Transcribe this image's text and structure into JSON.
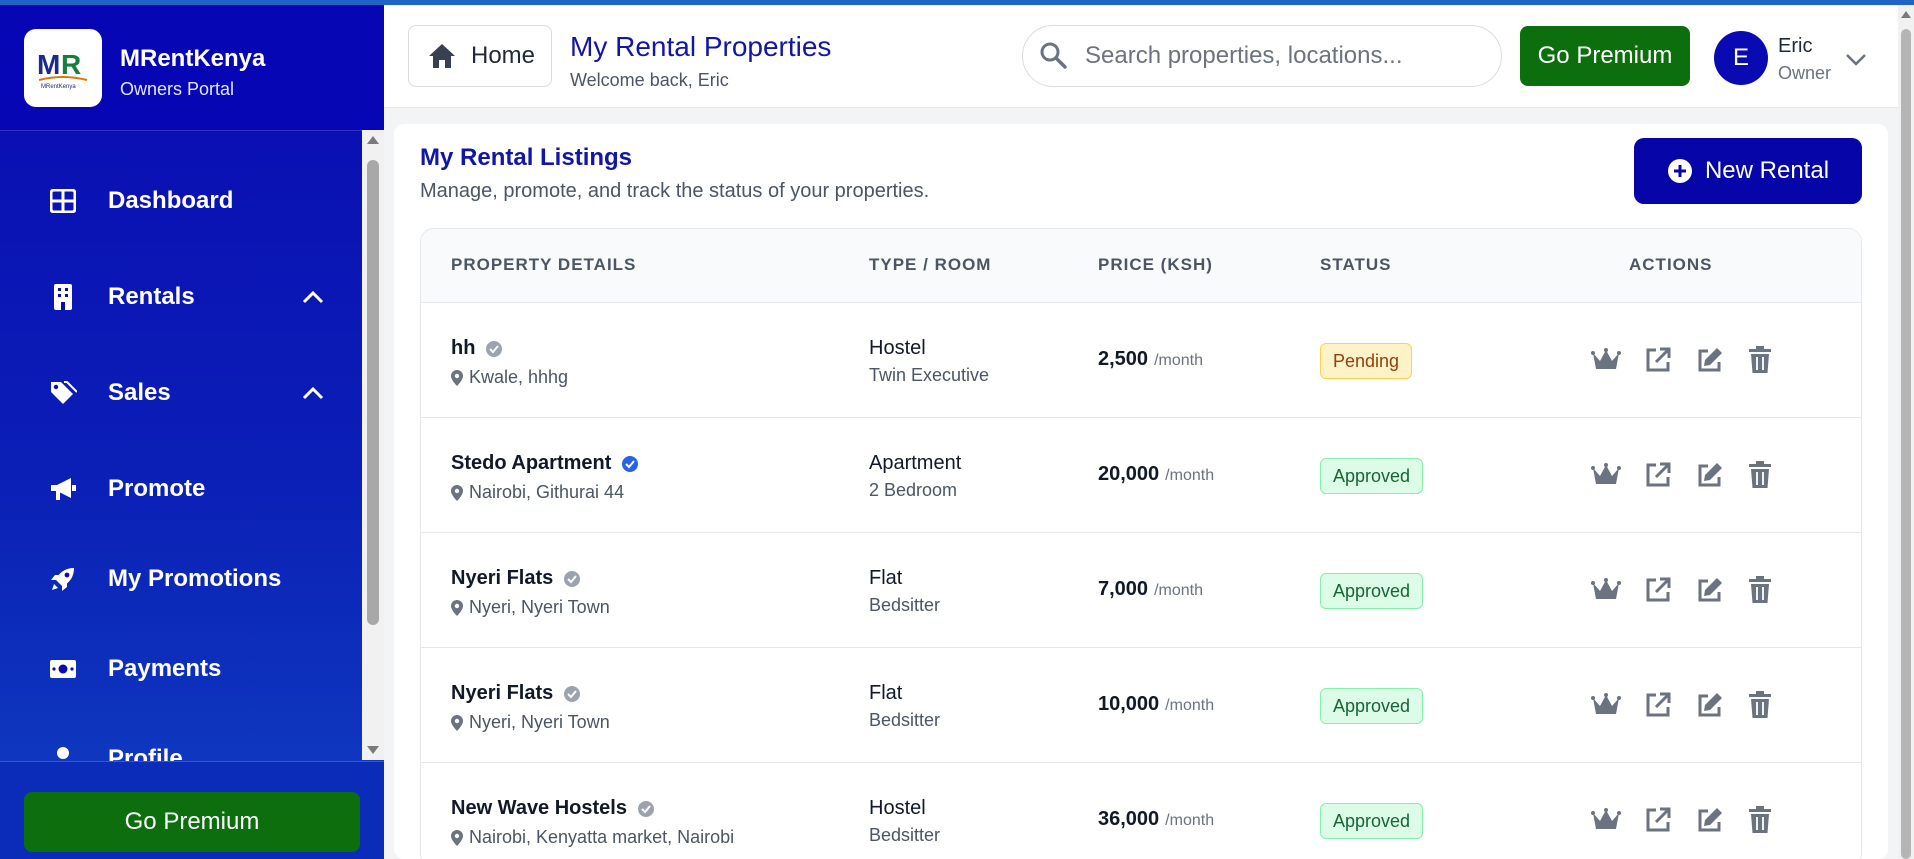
{
  "brand": {
    "name": "MRentKenya",
    "subtitle": "Owners Portal",
    "logo_text": "MR",
    "logo_small": "MRentKenya"
  },
  "sidebar": {
    "items": [
      {
        "label": "Dashboard",
        "icon": "grid-icon"
      },
      {
        "label": "Rentals",
        "icon": "building-icon",
        "expandable": true
      },
      {
        "label": "Sales",
        "icon": "tags-icon",
        "expandable": true
      },
      {
        "label": "Promote",
        "icon": "megaphone-icon"
      },
      {
        "label": "My Promotions",
        "icon": "rocket-icon"
      },
      {
        "label": "Payments",
        "icon": "money-icon"
      },
      {
        "label": "Profile",
        "icon": "user-icon"
      }
    ],
    "premium_label": "Go Premium"
  },
  "header": {
    "home_label": "Home",
    "title": "My Rental Properties",
    "subtitle": "Welcome back, Eric",
    "search_placeholder": "Search properties, locations...",
    "premium_label": "Go Premium",
    "user": {
      "initial": "E",
      "name": "Eric",
      "role": "Owner"
    }
  },
  "main": {
    "title": "My Rental Listings",
    "subtitle": "Manage, promote, and track the status of your properties.",
    "new_button": "New Rental",
    "columns": [
      "PROPERTY DETAILS",
      "TYPE / ROOM",
      "PRICE (KSH)",
      "STATUS",
      "ACTIONS"
    ],
    "price_unit": "/month",
    "rows": [
      {
        "name": "hh",
        "verified": false,
        "location": "Kwale, hhhg",
        "type": "Hostel",
        "room": "Twin Executive",
        "price": "2,500",
        "status": "Pending"
      },
      {
        "name": "Stedo Apartment",
        "verified": true,
        "location": "Nairobi, Githurai 44",
        "type": "Apartment",
        "room": "2 Bedroom",
        "price": "20,000",
        "status": "Approved"
      },
      {
        "name": "Nyeri Flats",
        "verified": false,
        "location": "Nyeri, Nyeri Town",
        "type": "Flat",
        "room": "Bedsitter",
        "price": "7,000",
        "status": "Approved"
      },
      {
        "name": "Nyeri Flats",
        "verified": false,
        "location": "Nyeri, Nyeri Town",
        "type": "Flat",
        "room": "Bedsitter",
        "price": "10,000",
        "status": "Approved"
      },
      {
        "name": "New Wave Hostels",
        "verified": false,
        "location": "Nairobi, Kenyatta market, Nairobi",
        "type": "Hostel",
        "room": "Bedsitter",
        "price": "36,000",
        "status": "Approved"
      }
    ]
  },
  "colors": {
    "sidebar": "#0a0ab3",
    "premium": "#0d6e0d",
    "accent": "#1016a6",
    "verified": "#2563eb",
    "unverified": "#9ca3af"
  }
}
